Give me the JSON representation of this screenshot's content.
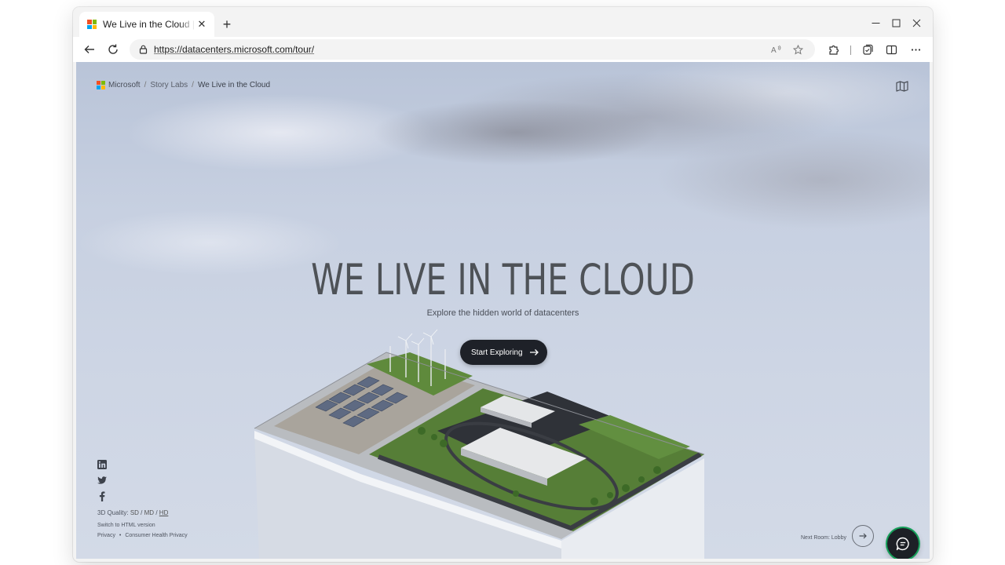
{
  "browser": {
    "tab": {
      "title": "We Live in the Cloud | Microsoft",
      "close": "✕"
    },
    "new_tab": "+",
    "window_controls": {
      "minimize": "—",
      "maximize": "☐",
      "close": "✕"
    },
    "address": {
      "url": "https://datacenters.microsoft.com/tour/"
    }
  },
  "page": {
    "breadcrumb": {
      "brand": "Microsoft",
      "sep1": "/",
      "item1": "Story Labs",
      "sep2": "/",
      "current": "We Live in the Cloud"
    },
    "hero": {
      "title": "WE LIVE IN THE CLOUD",
      "subtitle": "Explore the hidden world of datacenters",
      "cta_label": "Start Exploring"
    },
    "footer": {
      "quality_label": "3D Quality:",
      "quality_options": {
        "sd": "SD",
        "md": "MD",
        "hd": "HD",
        "sep": "/"
      },
      "html_switch": "Switch to HTML version",
      "privacy": "Privacy",
      "bullet": "•",
      "consumer_health": "Consumer Health Privacy"
    },
    "next_room_label": "Next Room: Lobby"
  },
  "colors": {
    "ms_red": "#f25022",
    "ms_green": "#7fba00",
    "ms_blue": "#00a4ef",
    "ms_yellow": "#ffb900",
    "cta_bg": "#1e2128",
    "chat_ring": "#16a05a"
  },
  "icons": [
    "back-arrow-icon",
    "refresh-icon",
    "lock-icon",
    "read-aloud-icon",
    "favorite-star-icon",
    "extensions-icon",
    "collections-icon",
    "split-screen-icon",
    "more-icon",
    "map-icon",
    "linkedin-icon",
    "twitter-icon",
    "facebook-icon",
    "arrow-right-icon",
    "chat-icon"
  ]
}
